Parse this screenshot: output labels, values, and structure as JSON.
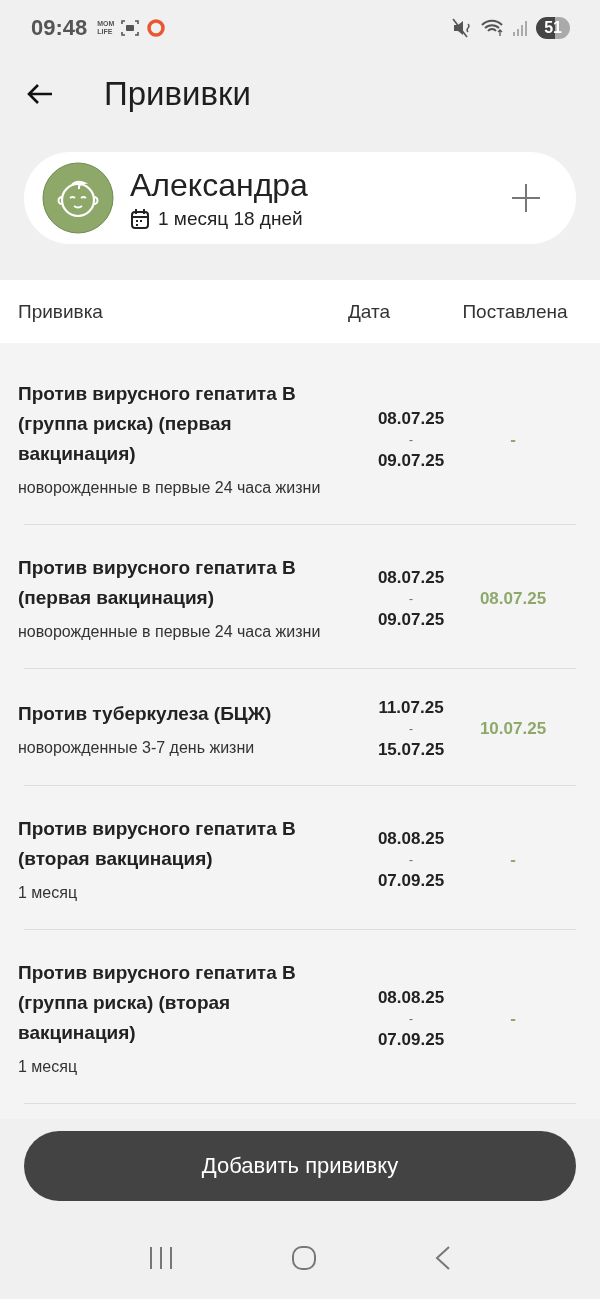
{
  "status_bar": {
    "time": "09:48",
    "app_badge": [
      "MOM",
      "LIFE"
    ],
    "battery": "51"
  },
  "header": {
    "title": "Прививки"
  },
  "child": {
    "name": "Александра",
    "age": "1 месяц 18 дней"
  },
  "table": {
    "columns": [
      "Прививка",
      "Дата",
      "Поставлена"
    ],
    "rows": [
      {
        "name": "Против вирусного гепатита В (группа риска) (первая вакцинация)",
        "note": "новорожденные в первые 24 часа жизни",
        "date_from": "08.07.25",
        "separator": "-",
        "date_to": "09.07.25",
        "given": "-"
      },
      {
        "name": "Против вирусного гепатита В (первая вакцинация)",
        "note": "новорожденные в первые 24 часа жизни",
        "date_from": "08.07.25",
        "separator": "-",
        "date_to": "09.07.25",
        "given": "08.07.25"
      },
      {
        "name": "Против туберкулеза (БЦЖ)",
        "note": "новорожденные 3-7 день жизни",
        "date_from": "11.07.25",
        "separator": "-",
        "date_to": "15.07.25",
        "given": "10.07.25"
      },
      {
        "name": "Против вирусного гепатита В (вторая вакцинация)",
        "note": "1 месяц",
        "date_from": "08.08.25",
        "separator": "-",
        "date_to": "07.09.25",
        "given": "-"
      },
      {
        "name": "Против вирусного гепатита В (группа риска) (вторая вакцинация)",
        "note": "1 месяц",
        "date_from": "08.08.25",
        "separator": "-",
        "date_to": "07.09.25",
        "given": "-"
      }
    ]
  },
  "add_button": "Добавить прививку"
}
